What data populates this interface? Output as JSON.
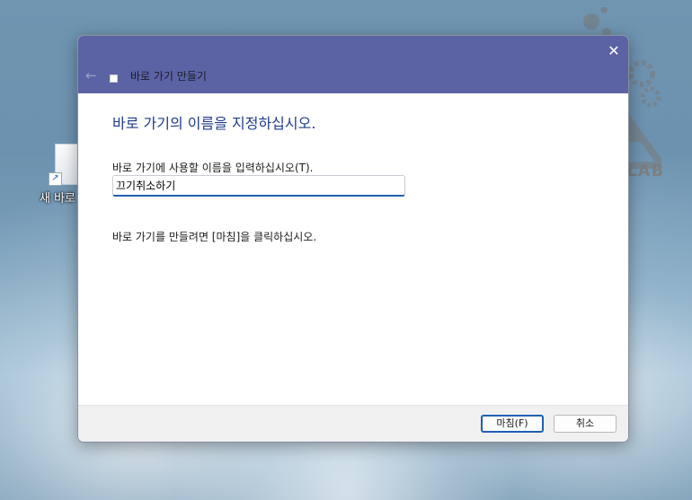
{
  "desktop": {
    "icon_label": "새 바로"
  },
  "watermark": {
    "text": "REFUR LAB"
  },
  "dialog": {
    "title": "바로 가기 만들기",
    "back_icon": "←",
    "close_icon": "✕",
    "heading": "바로 가기의 이름을 지정하십시오.",
    "field_label": "바로 가기에 사용할 이름을 입력하십시오(T).",
    "name_value": "끄기취소하기",
    "hint": "바로 가기를 만들려면 [마침]을 클릭하십시오.",
    "finish_label": "마침(F)",
    "cancel_label": "취소",
    "accent": "#1e5fb3",
    "titlebar_color": "#5b63a4"
  }
}
